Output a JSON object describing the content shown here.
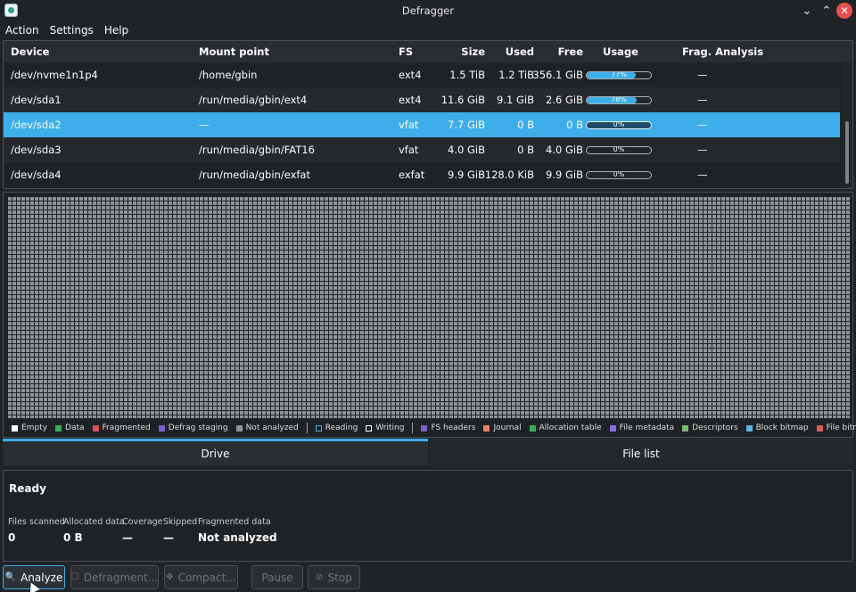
{
  "window": {
    "title": "Defragger"
  },
  "menu": [
    "Action",
    "Settings",
    "Help"
  ],
  "table": {
    "headers": {
      "device": "Device",
      "mount": "Mount point",
      "fs": "FS",
      "size": "Size",
      "used": "Used",
      "free": "Free",
      "usage": "Usage",
      "frag": "Frag. Analysis"
    },
    "rows": [
      {
        "device": "/dev/nvme1n1p4",
        "mount": "/home/gbin",
        "fs": "ext4",
        "size": "1.5 TiB",
        "used": "1.2 TiB",
        "free": "356.1 GiB",
        "usage": "77%",
        "usage_fraction": 0.77,
        "frag": "—"
      },
      {
        "device": "/dev/sda1",
        "mount": "/run/media/gbin/ext4",
        "fs": "ext4",
        "size": "11.6 GiB",
        "used": "9.1 GiB",
        "free": "2.6 GiB",
        "usage": "78%",
        "usage_fraction": 0.78,
        "frag": "—"
      },
      {
        "device": "/dev/sda2",
        "mount": "—",
        "fs": "vfat",
        "size": "7.7 GiB",
        "used": "0 B",
        "free": "0 B",
        "usage": "0%",
        "usage_fraction": 0,
        "frag": "—"
      },
      {
        "device": "/dev/sda3",
        "mount": "/run/media/gbin/FAT16",
        "fs": "vfat",
        "size": "4.0 GiB",
        "used": "0 B",
        "free": "4.0 GiB",
        "usage": "0%",
        "usage_fraction": 0,
        "frag": "—"
      },
      {
        "device": "/dev/sda4",
        "mount": "/run/media/gbin/exfat",
        "fs": "exfat",
        "size": "9.9 GiB",
        "used": "128.0 KiB",
        "free": "9.9 GiB",
        "usage": "0%",
        "usage_fraction": 0,
        "frag": "—"
      }
    ],
    "selected_index": 2
  },
  "legend": {
    "items": [
      {
        "label": "Empty",
        "color": "#ffffff",
        "style": "solid"
      },
      {
        "label": "Data",
        "color": "#3fa95f",
        "style": "solid"
      },
      {
        "label": "Fragmented",
        "color": "#d9534f",
        "style": "solid"
      },
      {
        "label": "Defrag staging",
        "color": "#7b61c9",
        "style": "solid"
      },
      {
        "label": "Not analyzed",
        "color": "#8e9399",
        "style": "solid"
      },
      {
        "label": "Reading",
        "color": "#3daee9",
        "style": "box"
      },
      {
        "label": "Writing",
        "color": "#ffffff",
        "style": "box"
      },
      {
        "label": "FS headers",
        "color": "#7b61c9",
        "style": "solid"
      },
      {
        "label": "Journal",
        "color": "#e9806a",
        "style": "solid"
      },
      {
        "label": "Allocation table",
        "color": "#3fa95f",
        "style": "solid"
      },
      {
        "label": "File metadata",
        "color": "#8c6ee0",
        "style": "solid"
      },
      {
        "label": "Descriptors",
        "color": "#7cb77c",
        "style": "solid"
      },
      {
        "label": "Block bitmap",
        "color": "#5fb4e6",
        "style": "solid"
      },
      {
        "label": "File bitmap",
        "color": "#d9605a",
        "style": "solid"
      }
    ]
  },
  "tabs": {
    "drive": "Drive",
    "files": "File list"
  },
  "status": {
    "title": "Ready",
    "stats": [
      {
        "label": "Files scanned",
        "value": "0"
      },
      {
        "label": "Allocated data",
        "value": "0 B"
      },
      {
        "label": "Coverage",
        "value": "—"
      },
      {
        "label": "Skipped",
        "value": "—"
      },
      {
        "label": "Fragmented data",
        "value": "Not analyzed"
      }
    ]
  },
  "buttons": {
    "analyze": "Analyze",
    "defragment": "Defragment...",
    "compact": "Compact...",
    "pause": "Pause",
    "stop": "Stop"
  },
  "window_controls": {
    "minimize": "⌄",
    "maximize": "⌃",
    "close": "✕"
  },
  "icons": {
    "analyze": "🔍",
    "defragment": "☐",
    "compact": "✥",
    "stop": "⊘"
  }
}
